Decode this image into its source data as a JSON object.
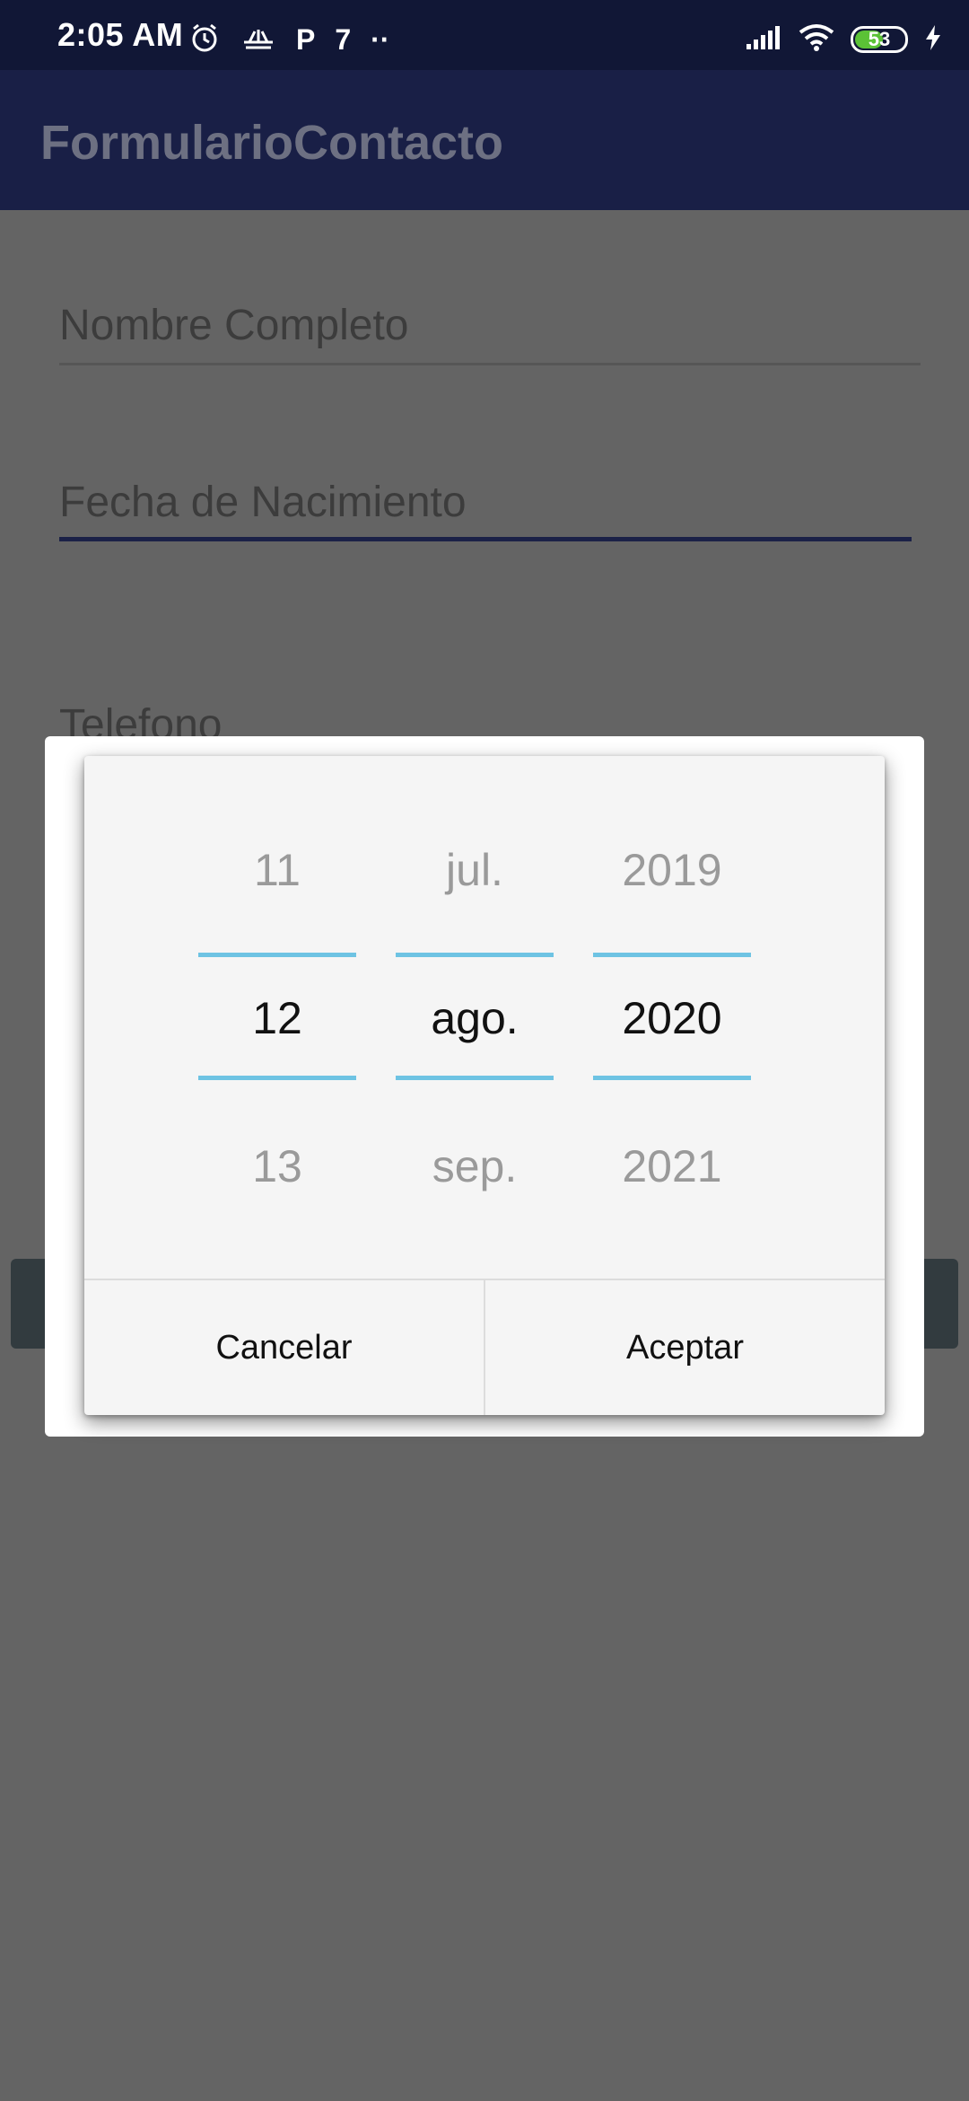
{
  "status_bar": {
    "time": "2:05 AM",
    "left_icons": [
      "alarm-icon",
      "notification-icon",
      "parking-app-icon",
      "app-icon",
      "more-dots-icon"
    ],
    "p_glyph": "P",
    "app_glyph": "7",
    "dots": "··",
    "battery_level": "53"
  },
  "app_bar": {
    "title": "FormularioContacto"
  },
  "form": {
    "name_placeholder": "Nombre Completo",
    "birthdate_placeholder": "Fecha de Nacimiento",
    "phone_placeholder": "Telefono"
  },
  "date_picker": {
    "day": {
      "prev": "11",
      "selected": "12",
      "next": "13"
    },
    "month": {
      "prev": "jul.",
      "selected": "ago.",
      "next": "sep."
    },
    "year": {
      "prev": "2019",
      "selected": "2020",
      "next": "2021"
    },
    "cancel_label": "Cancelar",
    "accept_label": "Aceptar"
  },
  "colors": {
    "status_bar": "#111736",
    "app_bar": "#191f46",
    "picker_divider": "#6ec3e3",
    "battery": "#5bc236"
  }
}
